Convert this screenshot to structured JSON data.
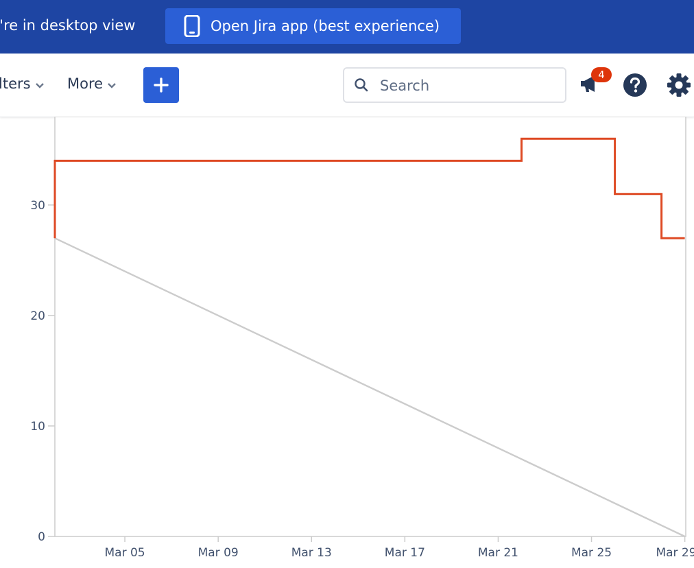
{
  "banner": {
    "desktop_text": "u're in desktop view",
    "open_app_label": "Open Jira app (best experience)"
  },
  "nav": {
    "filters_label": "lters",
    "more_label": "More",
    "create_label": "+",
    "search_placeholder": "Search",
    "notification_count": "4"
  },
  "colors": {
    "banner": "#1e45a3",
    "button": "#2b5fd6",
    "remaining": "#de4a24",
    "guideline": "#cccccc"
  },
  "icons": [
    "phone-icon",
    "chevron-down-icon",
    "plus-icon",
    "search-icon",
    "megaphone-icon",
    "help-icon",
    "gear-icon"
  ],
  "chart_data": {
    "type": "line",
    "title": "",
    "xlabel": "",
    "ylabel": "",
    "xlim": [
      "2019-03-02",
      "2019-03-29"
    ],
    "ylim": [
      0,
      38
    ],
    "y_ticks": [
      0,
      10,
      20,
      30
    ],
    "x_tick_labels": [
      "Mar 05",
      "Mar 09",
      "Mar 13",
      "Mar 17",
      "Mar 21",
      "Mar 25",
      "Mar 29"
    ],
    "x_tick_dates": [
      "2019-03-05",
      "2019-03-09",
      "2019-03-13",
      "2019-03-17",
      "2019-03-21",
      "2019-03-25",
      "2019-03-29"
    ],
    "series": [
      {
        "color": "#de4a24",
        "step": true,
        "points": [
          [
            "2019-03-02",
            27
          ],
          [
            "2019-03-02",
            34
          ],
          [
            "2019-03-22",
            34
          ],
          [
            "2019-03-22",
            36
          ],
          [
            "2019-03-26",
            36
          ],
          [
            "2019-03-26",
            31
          ],
          [
            "2019-03-28",
            31
          ],
          [
            "2019-03-28",
            27
          ],
          [
            "2019-03-29",
            27
          ]
        ]
      },
      {
        "color": "#cccccc",
        "step": false,
        "points": [
          [
            "2019-03-02",
            27
          ],
          [
            "2019-03-29",
            0
          ]
        ]
      }
    ]
  }
}
